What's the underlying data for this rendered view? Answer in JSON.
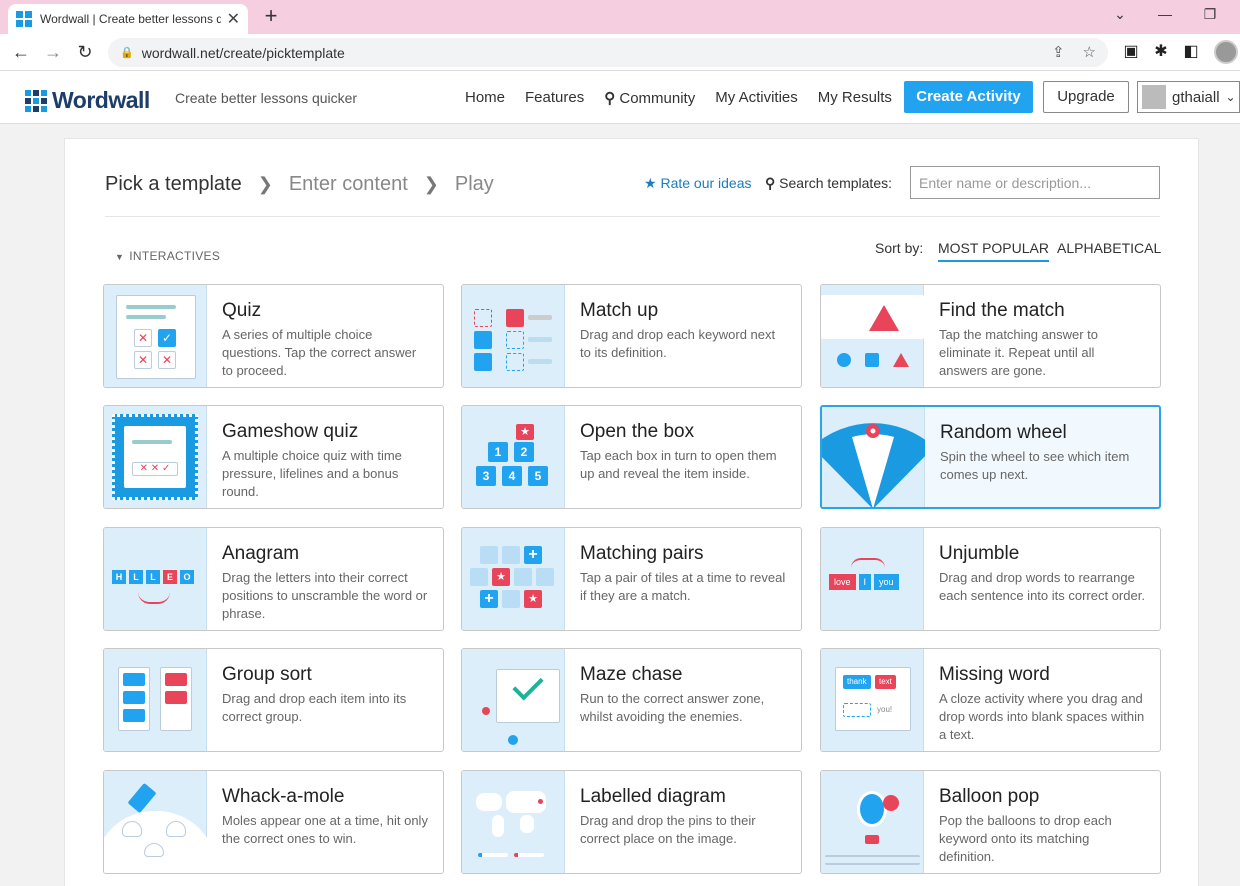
{
  "browser": {
    "tab_title": "Wordwall | Create better lessons q",
    "url": "wordwall.net/create/picktemplate"
  },
  "site": {
    "logo": "Wordwall",
    "tagline": "Create better lessons quicker",
    "nav": [
      "Home",
      "Features",
      "Community",
      "My Activities",
      "My Results"
    ],
    "create_button": "Create Activity",
    "upgrade_button": "Upgrade",
    "username": "gthaiall"
  },
  "page": {
    "steps": [
      "Pick a template",
      "Enter content",
      "Play"
    ],
    "rate_link": "Rate our ideas",
    "search_label": "Search templates:",
    "search_placeholder": "Enter name or description...",
    "section_title": "INTERACTIVES",
    "sort_label": "Sort by:",
    "sort_options": [
      "MOST POPULAR",
      "ALPHABETICAL"
    ]
  },
  "templates": [
    {
      "name": "Quiz",
      "desc": "A series of multiple choice questions. Tap the correct answer to proceed."
    },
    {
      "name": "Match up",
      "desc": "Drag and drop each keyword next to its definition."
    },
    {
      "name": "Find the match",
      "desc": "Tap the matching answer to eliminate it. Repeat until all answers are gone."
    },
    {
      "name": "Gameshow quiz",
      "desc": "A multiple choice quiz with time pressure, lifelines and a bonus round."
    },
    {
      "name": "Open the box",
      "desc": "Tap each box in turn to open them up and reveal the item inside."
    },
    {
      "name": "Random wheel",
      "desc": "Spin the wheel to see which item comes up next."
    },
    {
      "name": "Anagram",
      "desc": "Drag the letters into their correct positions to unscramble the word or phrase."
    },
    {
      "name": "Matching pairs",
      "desc": "Tap a pair of tiles at a time to reveal if they are a match."
    },
    {
      "name": "Unjumble",
      "desc": "Drag and drop words to rearrange each sentence into its correct order."
    },
    {
      "name": "Group sort",
      "desc": "Drag and drop each item into its correct group."
    },
    {
      "name": "Maze chase",
      "desc": "Run to the correct answer zone, whilst avoiding the enemies."
    },
    {
      "name": "Missing word",
      "desc": "A cloze activity where you drag and drop words into blank spaces within a text."
    },
    {
      "name": "Whack-a-mole",
      "desc": "Moles appear one at a time, hit only the correct ones to win."
    },
    {
      "name": "Labelled diagram",
      "desc": "Drag and drop the pins to their correct place on the image."
    },
    {
      "name": "Balloon pop",
      "desc": "Pop the balloons to drop each keyword onto its matching definition."
    }
  ],
  "thumb_text": {
    "anagram_letters": [
      "H",
      "L",
      "L",
      "E",
      "O"
    ],
    "box_numbers": [
      "1",
      "2",
      "3",
      "4",
      "5"
    ],
    "unjumble_words": [
      "love",
      "I",
      "you"
    ],
    "missing_words": [
      "thank",
      "text",
      "you!"
    ]
  },
  "colors": {
    "accent": "#22a3ef",
    "brand_dark": "#1d3d6b",
    "thumb_bg": "#dceefa",
    "red": "#e8445a"
  }
}
